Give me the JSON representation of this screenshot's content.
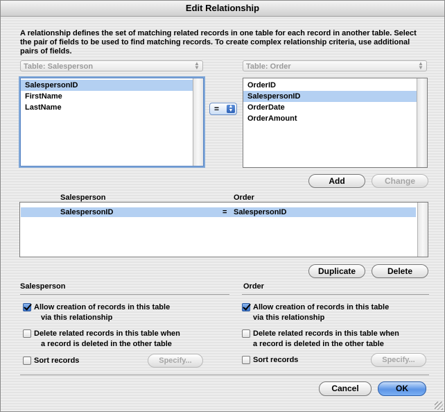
{
  "window": {
    "title": "Edit Relationship"
  },
  "description": "A relationship defines the set of matching related records in one table for each record in another table. Select the pair of fields to be used to find matching records. To create complex relationship criteria, use additional pairs of fields.",
  "left_table": {
    "label": "Table:",
    "value": "Salesperson",
    "fields": [
      "SalespersonID",
      "FirstName",
      "LastName"
    ],
    "selected_index": 0
  },
  "right_table": {
    "label": "Table:",
    "value": "Order",
    "fields": [
      "OrderID",
      "SalespersonID",
      "OrderDate",
      "OrderAmount"
    ],
    "selected_index": 1
  },
  "operator": {
    "value": "="
  },
  "buttons": {
    "add": "Add",
    "change": "Change",
    "duplicate": "Duplicate",
    "delete": "Delete",
    "specify_left": "Specify...",
    "specify_right": "Specify...",
    "cancel": "Cancel",
    "ok": "OK"
  },
  "relationships": {
    "header_left": "Salesperson",
    "header_right": "Order",
    "rows": [
      {
        "left": "SalespersonID",
        "op": "=",
        "right": "SalespersonID"
      }
    ]
  },
  "options_left": {
    "title": "Salesperson",
    "allow_creation_line1": "Allow creation of records in this table",
    "allow_creation_line2": "via this relationship",
    "allow_creation_checked": true,
    "delete_related_line1": "Delete related records in this table when",
    "delete_related_line2": "a record is deleted in the other table",
    "delete_related_checked": false,
    "sort_records": "Sort records",
    "sort_checked": false
  },
  "options_right": {
    "title": "Order",
    "allow_creation_line1": "Allow creation of records in this table",
    "allow_creation_line2": "via this relationship",
    "allow_creation_checked": true,
    "delete_related_line1": "Delete related records in this table when",
    "delete_related_line2": "a record is deleted in the other table",
    "delete_related_checked": false,
    "sort_records": "Sort records",
    "sort_checked": false
  },
  "colors": {
    "selection": "#b4d0f2",
    "default_button": "#5c95e6",
    "focus_ring": "#7fa7d8"
  }
}
